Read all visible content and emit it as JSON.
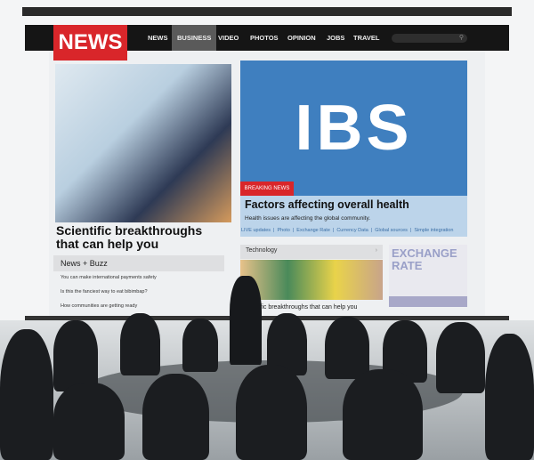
{
  "site": {
    "logo": "NEWS",
    "nav": [
      "NEWS",
      "BUSINESS",
      "VIDEO",
      "PHOTOS",
      "OPINION",
      "JOBS",
      "TRAVEL"
    ],
    "active_nav": "BUSINESS",
    "search_icon": "search-icon"
  },
  "hero": {
    "image_text": "IBS",
    "badge": "BREAKING NEWS",
    "title": "Factors affecting overall health",
    "subtitle": "Health issues are affecting the global community.",
    "links": [
      "LIVE updates",
      "Photo",
      "Exchange Rate",
      "Currency Data",
      "Global sources",
      "Simple integration"
    ]
  },
  "left": {
    "headline": "Scientific breakthroughs that can help you",
    "section": "News + Buzz",
    "items": [
      "You can make international payments safety",
      "Is this the fanciest way to eat bibimbap?",
      "How communities are getting ready"
    ]
  },
  "tech": {
    "label": "Technology",
    "chevron": "›",
    "caption": "ntific breakthroughs that can help you"
  },
  "exchange": {
    "title": "EXCHANGE RATE"
  },
  "colors": {
    "brand": "#d9262a",
    "nav": "#151515",
    "hero": "#3f7fbf"
  }
}
